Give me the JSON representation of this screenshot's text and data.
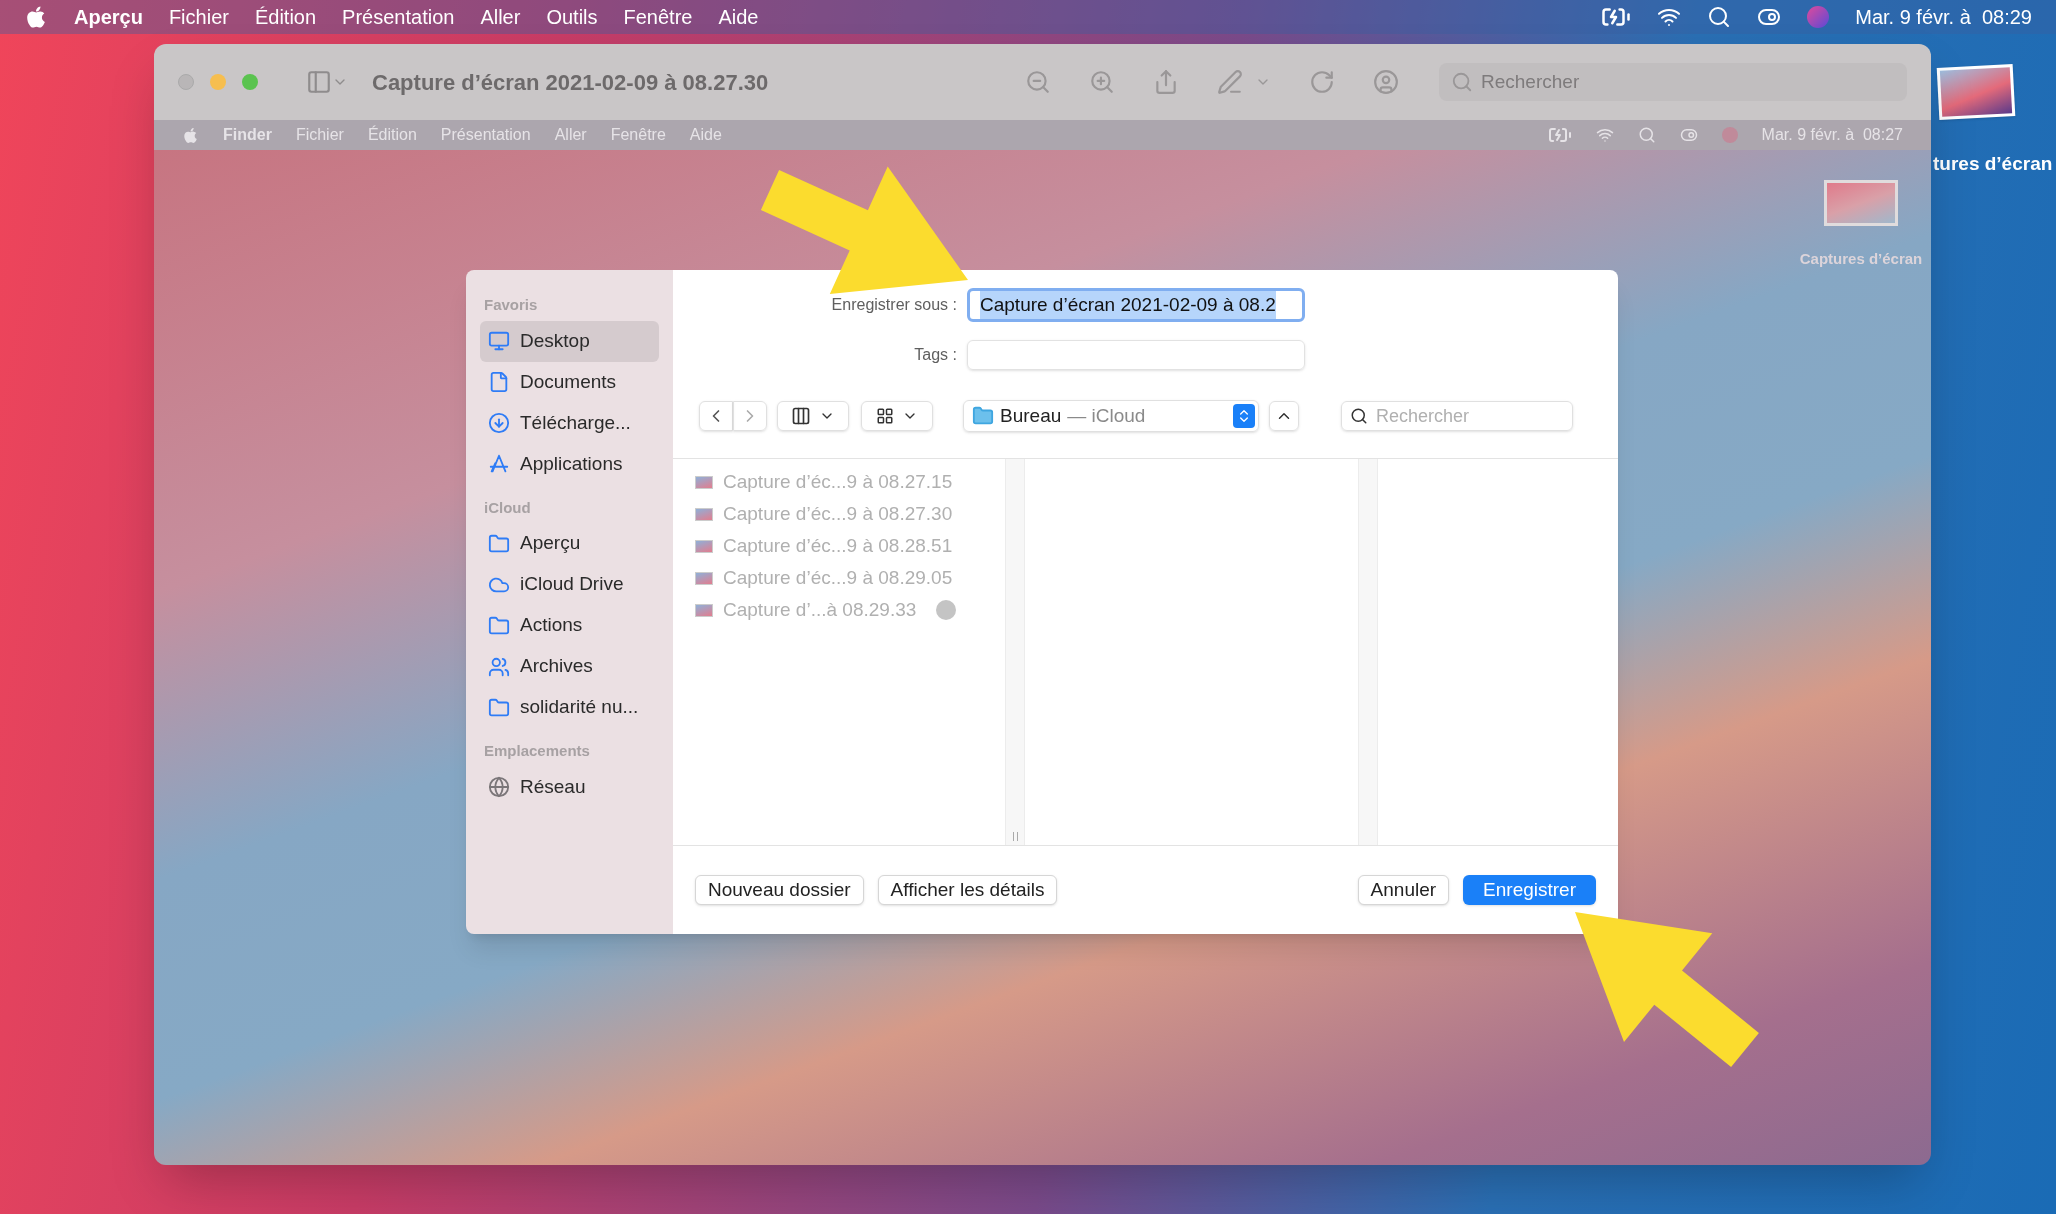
{
  "menu_bar": {
    "app": "Aperçu",
    "items": [
      "Fichier",
      "Édition",
      "Présentation",
      "Aller",
      "Outils",
      "Fenêtre",
      "Aide"
    ],
    "clock": "Mar. 9 févr. à  08:29"
  },
  "desktop_icon": {
    "label": "tures d’écran"
  },
  "window": {
    "title": "Capture d’écran 2021-02-09 à 08.27.30",
    "search": {
      "placeholder": "Rechercher"
    }
  },
  "inner_menu_bar": {
    "app": "Finder",
    "items": [
      "Fichier",
      "Édition",
      "Présentation",
      "Aller",
      "Fenêtre",
      "Aide"
    ],
    "clock": "Mar. 9 févr. à  08:27"
  },
  "inner_desktop_icon": {
    "label": "Captures d’écran"
  },
  "save_dialog": {
    "name_label": "Enregistrer sous :",
    "name_value": "Capture d’écran 2021-02-09 à 08.2",
    "tags_label": "Tags :",
    "location": {
      "folder": "Bureau",
      "account": "— iCloud"
    },
    "search": {
      "placeholder": "Rechercher"
    },
    "sidebar": [
      {
        "title": "Favoris",
        "items": [
          {
            "label": "Desktop",
            "kind": "desktop",
            "selected": true
          },
          {
            "label": "Documents",
            "kind": "document",
            "selected": false
          },
          {
            "label": "Télécharge...",
            "kind": "download",
            "selected": false
          },
          {
            "label": "Applications",
            "kind": "apps",
            "selected": false
          }
        ]
      },
      {
        "title": "iCloud",
        "items": [
          {
            "label": "Aperçu",
            "kind": "folder",
            "selected": false
          },
          {
            "label": "iCloud Drive",
            "kind": "cloud",
            "selected": false
          },
          {
            "label": "Actions",
            "kind": "folder",
            "selected": false
          },
          {
            "label": "Archives",
            "kind": "shared",
            "selected": false
          },
          {
            "label": "solidarité nu...",
            "kind": "folder",
            "selected": false
          }
        ]
      },
      {
        "title": "Emplacements",
        "items": [
          {
            "label": "Réseau",
            "kind": "network",
            "selected": false
          }
        ]
      }
    ],
    "files": [
      {
        "name": "Capture d’éc...9 à 08.27.15",
        "syncing": false
      },
      {
        "name": "Capture d’éc...9 à 08.27.30",
        "syncing": false
      },
      {
        "name": "Capture d’éc...9 à 08.28.51",
        "syncing": false
      },
      {
        "name": "Capture d’éc...9 à 08.29.05",
        "syncing": false
      },
      {
        "name": "Capture d’...à 08.29.33",
        "syncing": true
      }
    ],
    "left_buttons": [
      {
        "label": "Nouveau dossier",
        "default": false
      },
      {
        "label": "Afficher les détails",
        "default": false
      }
    ],
    "right_buttons": [
      {
        "label": "Annuler",
        "default": false
      },
      {
        "label": "Enregistrer",
        "default": true
      }
    ]
  }
}
